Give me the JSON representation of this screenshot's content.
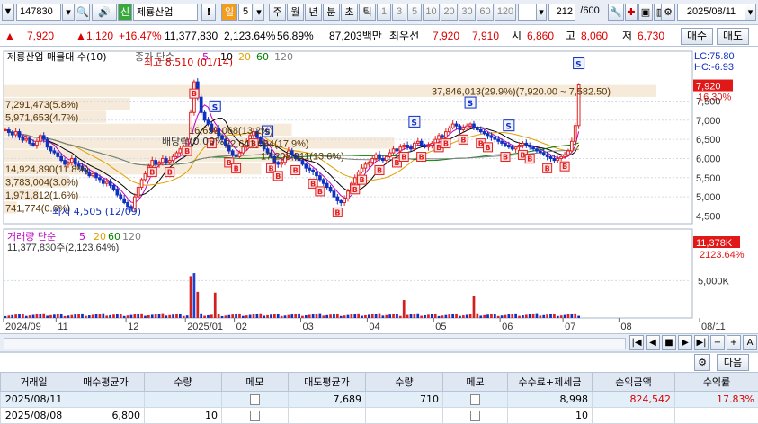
{
  "toolbar": {
    "code": "147830",
    "badge": "신",
    "name": "제룡산업",
    "excl": "!",
    "period_label": "일",
    "period_value": "5",
    "tabs": [
      "주",
      "월",
      "년",
      "분",
      "초",
      "틱"
    ],
    "intervals": [
      "1",
      "3",
      "5",
      "10",
      "20",
      "30",
      "60",
      "120"
    ],
    "count": "212",
    "count_total": "/600",
    "date": "2025/08/11"
  },
  "quote": {
    "price": "7,920",
    "change": "1,120",
    "change_pct": "+16.47%",
    "volume": "11,377,830",
    "volume_ratio": "2,123.64%",
    "turnover": "56.89%",
    "amount": "87,203백만",
    "priority_label": "최우선",
    "ask": "7,920",
    "bid": "7,910",
    "open_label": "시",
    "open": "6,860",
    "high_label": "고",
    "high": "8,060",
    "low_label": "저",
    "low": "6,730",
    "buy_label": "매수",
    "sell_label": "매도"
  },
  "chart_data": [
    {
      "type": "candlestick",
      "title": "제룡산업 매물대 수(10)",
      "ma_label": "종가 단순",
      "ma_periods": [
        "5",
        "10",
        "20",
        "60",
        "120"
      ],
      "ma_colors": [
        "#c000c0",
        "#000000",
        "#e0a000",
        "#008000",
        "#808080"
      ],
      "ylim": [
        4300,
        8800
      ],
      "y_ticks": [
        "7,500",
        "7,000",
        "6,500",
        "6,000",
        "5,500",
        "5,000",
        "4,500"
      ],
      "y_tick_values": [
        7500,
        7000,
        6500,
        6000,
        5500,
        5000,
        4500
      ],
      "lc": "LC:75.80",
      "hc": "HC:-6.93",
      "last_price": "7,920",
      "last_pct": "16.30%",
      "high_note": "최고 8,510 (01/14)",
      "low_note": "최저 4,505 (12/09)",
      "dividend_note": "배당락(0.00%)",
      "volume_profile": [
        {
          "label": "37,846,013(29.9%)(7,920.00 ~ 7,582.50)",
          "low": 7582.5,
          "high": 7920,
          "pct": 29.9
        },
        {
          "label": "7,291,473(5.8%)",
          "low": 7245,
          "high": 7582.5,
          "pct": 5.8
        },
        {
          "label": "5,971,653(4.7%)",
          "low": 6907.5,
          "high": 7245,
          "pct": 4.7
        },
        {
          "label": "16,659,068(13.2%)",
          "low": 6570,
          "high": 6907.5,
          "pct": 13.2
        },
        {
          "label": "22,641,084(17.9%)",
          "low": 6232.5,
          "high": 6570,
          "pct": 17.9
        },
        {
          "label": "17,208,911(13.6%)",
          "low": 5895,
          "high": 6232.5,
          "pct": 13.6
        },
        {
          "label": "14,924,890(11.8%)",
          "low": 5557.5,
          "high": 5895,
          "pct": 11.8
        },
        {
          "label": "3,783,004(3.0%)",
          "low": 5220,
          "high": 5557.5,
          "pct": 3.0
        },
        {
          "label": "1,971,812(1.6%)",
          "low": 4882.5,
          "high": 5220,
          "pct": 1.6
        },
        {
          "label": "741,774(0.6%)",
          "low": 4545,
          "high": 4882.5,
          "pct": 0.6
        }
      ],
      "closes": [
        6750,
        6680,
        6620,
        6700,
        6550,
        6480,
        6520,
        6400,
        6350,
        6450,
        6600,
        6500,
        6300,
        6200,
        6150,
        6050,
        5950,
        5850,
        5900,
        6000,
        5850,
        5800,
        5700,
        5650,
        5550,
        5600,
        5500,
        5450,
        5350,
        5400,
        5300,
        5200,
        5050,
        4950,
        4850,
        4750,
        4700,
        5000,
        5250,
        5450,
        5600,
        5800,
        5950,
        5850,
        5900,
        6000,
        5900,
        5950,
        6050,
        6150,
        6250,
        6300,
        6500,
        7200,
        8000,
        7600,
        7200,
        7000,
        6900,
        6700,
        6800,
        6600,
        6500,
        6350,
        6200,
        6100,
        6050,
        6150,
        6300,
        6450,
        6600,
        6700,
        6550,
        6400,
        6250,
        6150,
        6050,
        5900,
        5850,
        5900,
        6050,
        6200,
        6100,
        6000,
        5950,
        5850,
        5750,
        5700,
        5650,
        5550,
        5450,
        5350,
        5250,
        5150,
        5000,
        4900,
        4850,
        4950,
        5150,
        5350,
        5500,
        5650,
        5750,
        5850,
        5900,
        6000,
        6100,
        6000,
        5950,
        6050,
        6150,
        6250,
        6200,
        6300,
        6350,
        6300,
        6250,
        6400,
        6450,
        6350,
        6300,
        6350,
        6400,
        6500,
        6600,
        6550,
        6700,
        6800,
        6900,
        6850,
        6750,
        6800,
        6850,
        6900,
        6800,
        6750,
        6700,
        6650,
        6600,
        6550,
        6500,
        6450,
        6400,
        6350,
        6300,
        6250,
        6300,
        6350,
        6400,
        6350,
        6300,
        6250,
        6200,
        6150,
        6100,
        6050,
        6000,
        5950,
        6000,
        6050,
        6100,
        6200,
        6450,
        6860,
        7920
      ],
      "buy_marker_count": 30,
      "sell_marker_count": 6,
      "signal_buy_label": "B",
      "signal_sell_label": "S"
    },
    {
      "type": "bar",
      "title": "거래량 단순",
      "ma_periods": [
        "5",
        "20",
        "60",
        "120"
      ],
      "subtitle": "11,377,830주(2,123.64%)",
      "y_ticks": [
        "5,000K"
      ],
      "y_tick_values": [
        5000
      ],
      "ylim": [
        0,
        11900
      ],
      "last_value": "11,378K",
      "last_pct": "2123.64%",
      "spikes": [
        {
          "index": 53,
          "value": 5600,
          "color": "#d02020"
        },
        {
          "index": 54,
          "value": 6000,
          "color": "#2040d0"
        },
        {
          "index": 55,
          "value": 3500,
          "color": "#d02020"
        },
        {
          "index": 60,
          "value": 3400,
          "color": "#d02020"
        },
        {
          "index": 114,
          "value": 2400,
          "color": "#d02020"
        },
        {
          "index": 134,
          "value": 2900,
          "color": "#d02020"
        },
        {
          "index": 166,
          "value": 11378,
          "color": "#d02020"
        }
      ]
    }
  ],
  "x_axis": {
    "labels": [
      "2024/09",
      "11",
      "12",
      "2025/01",
      "02",
      "03",
      "04",
      "05",
      "06",
      "07",
      "08",
      "08/11"
    ],
    "label_index": [
      0,
      15,
      35,
      52,
      66,
      85,
      104,
      123,
      142,
      160,
      176,
      196
    ]
  },
  "nav_buttons": [
    "|◀",
    "◀",
    "■",
    "▶",
    "▶|",
    "−",
    "+",
    "A"
  ],
  "trade_tools": {
    "next_label": "다음"
  },
  "trade_table": {
    "headers": [
      "거래일",
      "매수평균가",
      "수량",
      "메모",
      "매도평균가",
      "수량",
      "메모",
      "수수료+제세금",
      "손익금액",
      "수익률"
    ],
    "rows": [
      {
        "date": "2025/08/11",
        "buy_avg": "",
        "buy_qty": "",
        "sell_avg": "7,689",
        "sell_qty": "710",
        "fee": "8,998",
        "pnl": "824,542",
        "ret": "17.83%"
      },
      {
        "date": "2025/08/08",
        "buy_avg": "6,800",
        "buy_qty": "10",
        "sell_avg": "",
        "sell_qty": "",
        "fee": "10",
        "pnl": "",
        "ret": ""
      }
    ]
  },
  "colors": {
    "up": "#e02020",
    "down": "#1030c0",
    "accent": "#c000c0",
    "profile": "#f5e6d3"
  }
}
